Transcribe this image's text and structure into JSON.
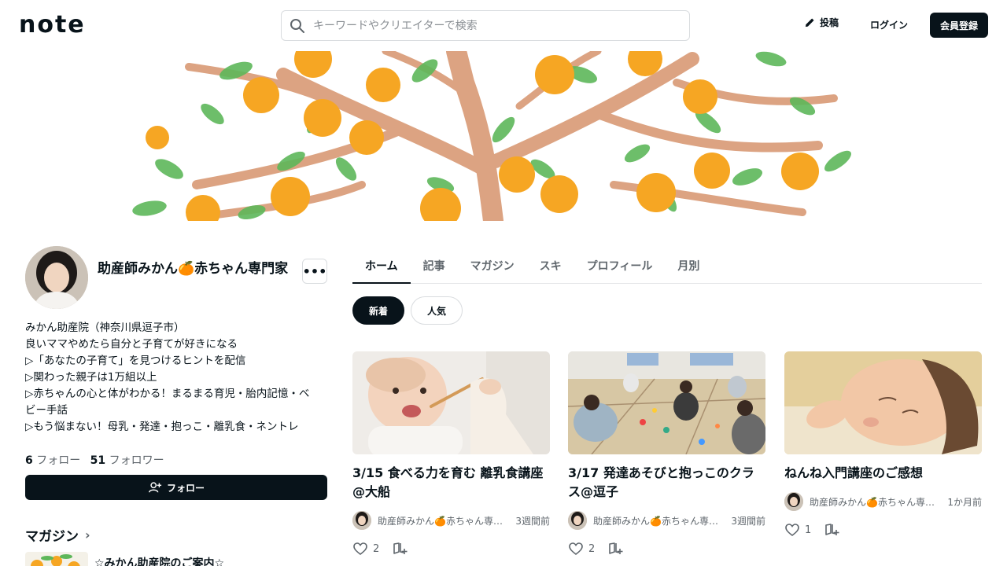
{
  "header": {
    "logo": "note",
    "search_placeholder": "キーワードやクリエイターで検索",
    "post_label": "投稿",
    "login_label": "ログイン",
    "signup_label": "会員登録"
  },
  "profile": {
    "name": "助産師みかん🍊赤ちゃん専門家",
    "more_label": "•••",
    "bio": [
      "みかん助産院（神奈川県逗子市）",
      "良いママやめたら自分と子育てが好きになる",
      "▷「あなたの子育て」を見つけるヒントを配信",
      "▷関わった親子は1万組以上",
      "▷赤ちゃんの心と体がわかる！まるまる育児・胎内記憶・ベ",
      "ビー手話",
      "▷もう悩まない！母乳・発達・抱っこ・離乳食・ネントレ"
    ],
    "following_count": "6",
    "following_label": "フォロー",
    "follower_count": "51",
    "follower_label": "フォロワー",
    "follow_button": "フォロー",
    "magazine_heading": "マガジン",
    "magazine_item_title": "☆みかん助産院のご案内☆"
  },
  "tabs": [
    "ホーム",
    "記事",
    "マガジン",
    "スキ",
    "プロフィール",
    "月別"
  ],
  "active_tab": "ホーム",
  "sort_chips": [
    "新着",
    "人気"
  ],
  "cards": [
    {
      "title": "3/15 食べる力を育む 離乳食講座@大船",
      "author": "助産師みかん🍊赤ちゃん専門家",
      "time": "3週間前",
      "likes": "2",
      "image_icon": "baby-eating-photo"
    },
    {
      "title": "3/17 発達あそびと抱っこのクラス@逗子",
      "author": "助産師みかん🍊赤ちゃん専門家",
      "time": "3週間前",
      "likes": "2",
      "image_icon": "class-room-photo"
    },
    {
      "title": "ねんね入門講座のご感想",
      "author": "助産師みかん🍊赤ちゃん専門家",
      "time": "1か月前",
      "likes": "1",
      "image_icon": "sleeping-baby-photo"
    }
  ],
  "colors": {
    "primary": "#08131a",
    "muted": "#5f666c",
    "border": "#d9dcdf",
    "orange": "#f6a623",
    "leaf": "#4aaa4a",
    "branch": "#d9a07a"
  }
}
